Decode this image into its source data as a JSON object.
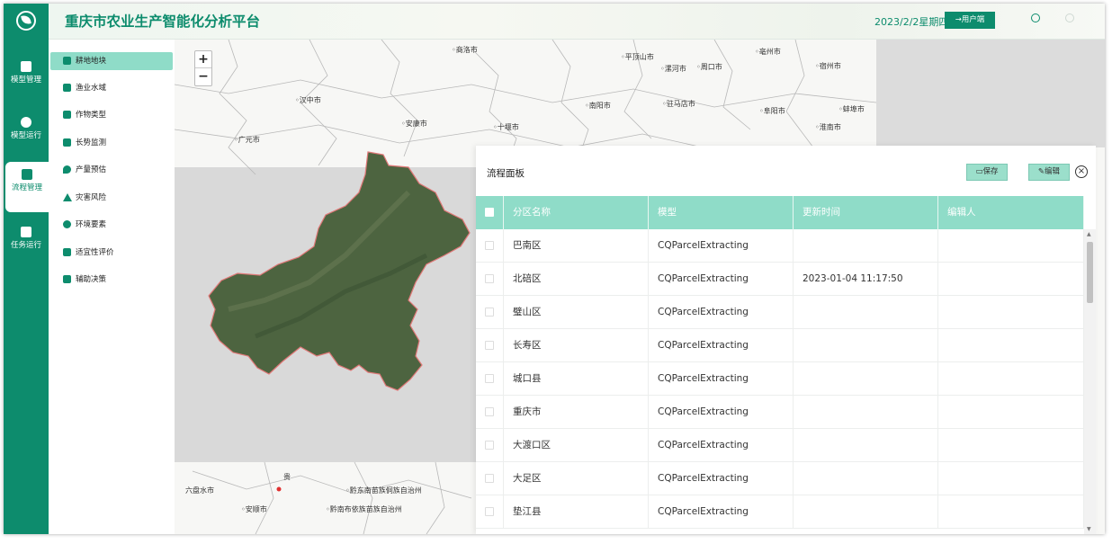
{
  "header": {
    "title": "重庆市农业生产智能化分析平台",
    "date": "2023/2/2星期四",
    "user_button": "→用户端",
    "icons": [
      "user-circle-icon",
      "power-icon"
    ],
    "accent_color": "#0d8c6d"
  },
  "rail": {
    "items": [
      {
        "label": "模型管理",
        "icon": "model-icon"
      },
      {
        "label": "模型运行",
        "icon": "play-icon"
      },
      {
        "label": "流程管理",
        "icon": "flow-icon",
        "active": true
      },
      {
        "label": "任务运行",
        "icon": "task-icon"
      }
    ]
  },
  "sidebar": {
    "items": [
      {
        "label": "耕地地块",
        "icon": "parcel-icon",
        "active": true
      },
      {
        "label": "渔业水域",
        "icon": "fishery-icon"
      },
      {
        "label": "作物类型",
        "icon": "crop-icon"
      },
      {
        "label": "长势监测",
        "icon": "monitor-icon"
      },
      {
        "label": "产量预估",
        "icon": "yield-icon"
      },
      {
        "label": "灾害风险",
        "icon": "warning-icon"
      },
      {
        "label": "环境要素",
        "icon": "environment-icon"
      },
      {
        "label": "适宜性评价",
        "icon": "evaluation-icon"
      },
      {
        "label": "辅助决策",
        "icon": "decision-icon"
      }
    ]
  },
  "map": {
    "zoom_in": "+",
    "zoom_out": "−",
    "cities": [
      "◦商洛市",
      "◦平顶山市",
      "◦漯河市",
      "◦周口市",
      "◦亳州市",
      "◦宿州市",
      "◦汉中市",
      "◦南阳市",
      "◦驻马店市",
      "◦阜阳市",
      "◦蚌埠市",
      "◦安康市",
      "◦十堰市",
      "◦淮南市",
      "◦广元市",
      "六盘水市",
      "贵",
      "◦安顺市",
      "◦黔东南苗族侗族自治州",
      "◦黔南布依族苗族自治州"
    ]
  },
  "panel": {
    "title": "流程面板",
    "save_label": "保存",
    "edit_label": "编辑",
    "close_label": "×",
    "columns": [
      "分区名称",
      "模型",
      "更新时间",
      "编辑人"
    ],
    "rows": [
      [
        "巴南区",
        "CQParcelExtracting",
        "",
        ""
      ],
      [
        "北碚区",
        "CQParcelExtracting",
        "2023-01-04 11:17:50",
        ""
      ],
      [
        "璧山区",
        "CQParcelExtracting",
        "",
        ""
      ],
      [
        "长寿区",
        "CQParcelExtracting",
        "",
        ""
      ],
      [
        "城口县",
        "CQParcelExtracting",
        "",
        ""
      ],
      [
        "重庆市",
        "CQParcelExtracting",
        "",
        ""
      ],
      [
        "大渡口区",
        "CQParcelExtracting",
        "",
        ""
      ],
      [
        "大足区",
        "CQParcelExtracting",
        "",
        ""
      ],
      [
        "垫江县",
        "CQParcelExtracting",
        "",
        ""
      ]
    ]
  }
}
